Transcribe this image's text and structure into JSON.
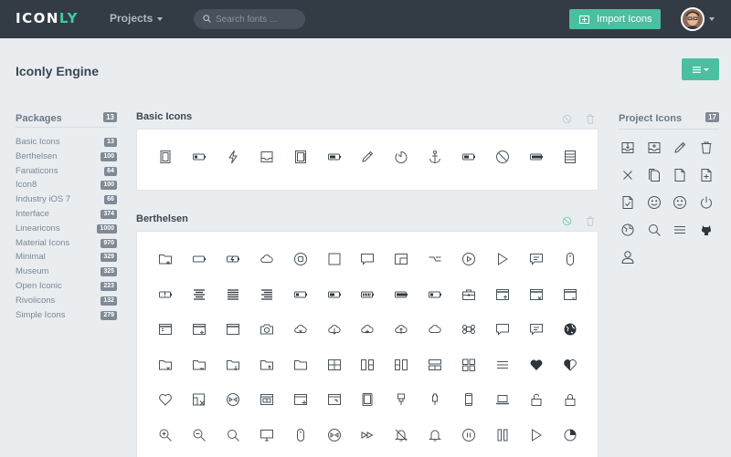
{
  "header": {
    "logo_main": "ICON",
    "logo_accent": "LY",
    "nav_projects": "Projects",
    "search_placeholder": "Search fonts ...",
    "import_label": "Import Icons"
  },
  "page": {
    "title": "Iconly Engine"
  },
  "sidebar": {
    "title": "Packages",
    "count": "13",
    "items": [
      {
        "label": "Basic Icons",
        "count": "13"
      },
      {
        "label": "Berthelsen",
        "count": "100"
      },
      {
        "label": "Fanaticons",
        "count": "64"
      },
      {
        "label": "Icon8",
        "count": "100"
      },
      {
        "label": "Industry iOS 7",
        "count": "66"
      },
      {
        "label": "Interface",
        "count": "374"
      },
      {
        "label": "Linearicons",
        "count": "1000"
      },
      {
        "label": "Material Icons",
        "count": "970"
      },
      {
        "label": "Minimal",
        "count": "329"
      },
      {
        "label": "Museum",
        "count": "325"
      },
      {
        "label": "Open Iconic",
        "count": "223"
      },
      {
        "label": "Rivolicons",
        "count": "132"
      },
      {
        "label": "Simple Icons",
        "count": "279"
      }
    ]
  },
  "basic_icons": {
    "title": "Basic Icons",
    "icons": [
      "document-icon",
      "battery-low-icon",
      "lightning-icon",
      "inbox-icon",
      "notebook-icon",
      "battery-mid-icon",
      "notepad-pencil-icon",
      "timer-icon",
      "anchor-icon",
      "battery-half-icon",
      "no-entry-icon",
      "battery-full-icon",
      "archive-tray-icon"
    ]
  },
  "berthelsen": {
    "title": "Berthelsen",
    "rows": [
      [
        "folder-add-icon",
        "battery-empty-icon",
        "battery-charging-icon",
        "cloud-icon",
        "record-button-icon",
        "square-icon",
        "speech-bubble-icon",
        "window-resize-icon",
        "toggle-switch-icon",
        "play-circle-icon",
        "play-icon",
        "chat-message-icon",
        "mouse-icon"
      ],
      [
        "battery-alert-icon",
        "align-center-icon",
        "align-justify-icon",
        "align-right-icon",
        "battery-quarter-icon",
        "battery-half-icon",
        "battery-three-quarter-icon",
        "battery-full-icon",
        "battery-low-icon",
        "briefcase-icon",
        "browser-upload-icon",
        "browser-close-icon",
        "browser-minimize-icon"
      ],
      [
        "browser-list-icon",
        "browser-add-icon",
        "browser-window-icon",
        "camera-icon",
        "cloud-close-icon",
        "cloud-download-icon",
        "cloud-add-icon",
        "cloud-upload-icon",
        "cloud-outline-icon",
        "command-key-icon",
        "chat-bubble-icon",
        "chat-lines-icon",
        "globe-filled-icon"
      ],
      [
        "folder-close-icon",
        "folder-remove-icon",
        "folder-download-icon",
        "folder-upload-icon",
        "folder-icon",
        "layout-grid-icon",
        "layout-columns-icon",
        "layout-split-icon",
        "layout-rows-icon",
        "layout-quad-icon",
        "menu-lines-icon",
        "heart-filled-icon",
        "heart-half-icon"
      ],
      [
        "heart-outline-icon",
        "image-close-icon",
        "film-reel-icon",
        "window-split-icon",
        "window-add-icon",
        "window-corner-icon",
        "tablet-icon",
        "usb-plug-icon",
        "usb-cable-icon",
        "phone-icon",
        "laptop-icon",
        "unlock-icon",
        "lock-icon"
      ],
      [
        "zoom-in-icon",
        "zoom-out-icon",
        "search-icon",
        "monitor-icon",
        "mouse-device-icon",
        "reel-icon",
        "fast-forward-icon",
        "bell-off-icon",
        "bell-icon",
        "pause-circle-icon",
        "pause-bars-icon",
        "display-icon",
        "pie-chart-icon"
      ]
    ]
  },
  "project_icons": {
    "title": "Project Icons",
    "count": "17",
    "icons": [
      "inbox-download-icon",
      "inbox-add-icon",
      "pencil-icon",
      "trash-icon",
      "close-icon",
      "documents-icon",
      "file-icon",
      "file-add-icon",
      "file-check-icon",
      "face-happy-icon",
      "face-smile-icon",
      "power-icon",
      "globe-icon",
      "search-icon",
      "menu-icon",
      "github-icon",
      "user-icon"
    ]
  },
  "colors": {
    "topbar": "#333b45",
    "accent": "#4bbfa0",
    "background": "#e9edf0",
    "badge": "#7f8a95"
  }
}
